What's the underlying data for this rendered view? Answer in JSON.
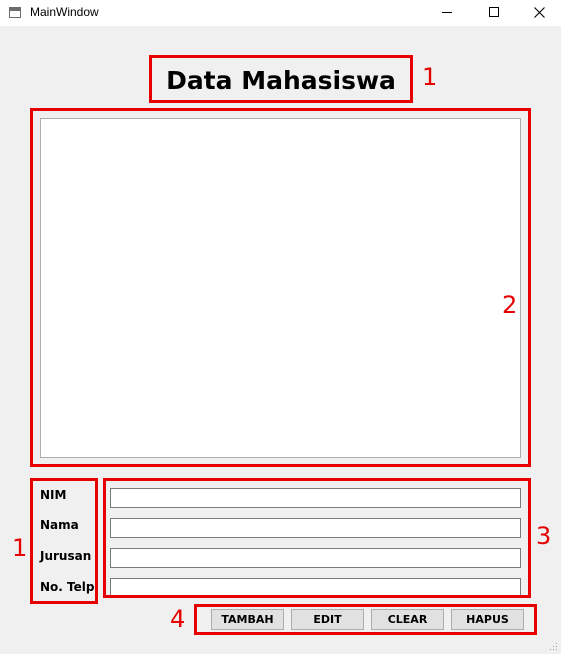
{
  "window": {
    "title": "MainWindow"
  },
  "heading": "Data Mahasiswa",
  "annotations": {
    "heading_marker": "1",
    "table_marker": "2",
    "labels_marker": "1",
    "fields_marker": "3",
    "buttons_marker": "4"
  },
  "form": {
    "labels": [
      "NIM",
      "Nama",
      "Jurusan",
      "No. Telp"
    ],
    "values": [
      "",
      "",
      "",
      ""
    ]
  },
  "buttons": {
    "add": "TAMBAH",
    "edit": "EDIT",
    "clear": "CLEAR",
    "delete": "HAPUS"
  },
  "icons": [
    "app-icon",
    "minimize-icon",
    "maximize-icon",
    "close-icon",
    "resize-grip-icon"
  ],
  "colors": {
    "annotation": "#e60000",
    "background": "#f0f0f0"
  }
}
